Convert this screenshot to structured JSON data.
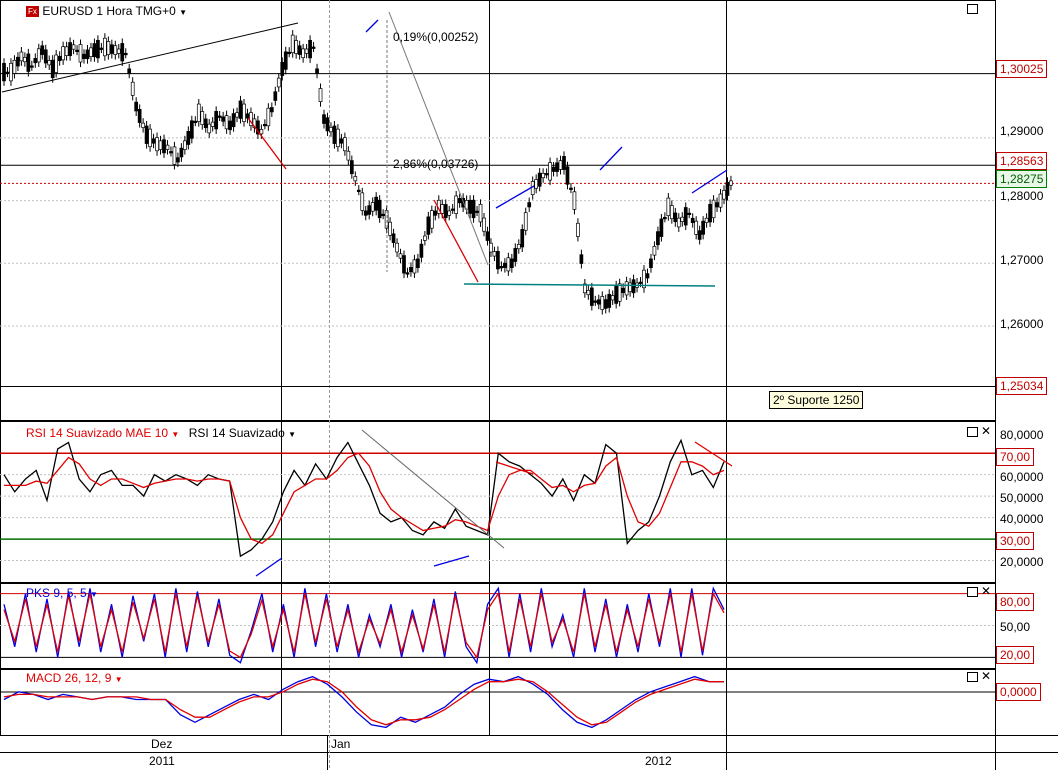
{
  "header": {
    "symbol_icon": "fx-icon",
    "title": "EURUSD 1 Hora TMG+0",
    "dropdown_icon": "triangle-down-icon"
  },
  "price_panel": {
    "axis_ticks": [
      "1,29000",
      "1,28000",
      "1,27000",
      "1,26000"
    ],
    "levels": [
      {
        "label": "1,30025",
        "style": "level"
      },
      {
        "label": "1,28563",
        "style": "level"
      },
      {
        "label": "1,28275",
        "style": "current"
      },
      {
        "label": "1,25034",
        "style": "level"
      }
    ],
    "annotations": {
      "fib_top": "0,19%(0,00252)",
      "fib_mid": "2,86%(0,03726)",
      "support_note": "2º Suporte 1250"
    }
  },
  "rsi_panel": {
    "title_red": "RSI 14 Suavizado MAE 10",
    "title_black": "RSI 14 Suavizado",
    "axis_ticks": [
      "80,0000",
      "60,0000",
      "50,0000",
      "40,0000",
      "20,0000"
    ],
    "levels": [
      "70,00",
      "30,00"
    ]
  },
  "pks_panel": {
    "title": "PKS 9, 5, 5",
    "axis_ticks": [
      "50,00"
    ],
    "levels": [
      "80,00",
      "20,00"
    ]
  },
  "macd_panel": {
    "title": "MACD 26, 12, 9",
    "levels": [
      "0,0000"
    ]
  },
  "time_axis": {
    "months": [
      "Dez",
      "Jan"
    ],
    "years": [
      "2011",
      "2012"
    ]
  },
  "colors": {
    "price": "#000000",
    "rising_candle": "#ffffff",
    "red": "#e00000",
    "blue": "#0000e0",
    "green": "#007000",
    "teal": "#008080",
    "grid": "#c0c0c0"
  },
  "chart_data": [
    {
      "type": "line",
      "title": "EURUSD 1 Hora TMG+0",
      "ylim": [
        1.245,
        1.312
      ],
      "series": [
        {
          "name": "EURUSD",
          "values": [
            1.3005,
            1.303,
            1.3015,
            1.304,
            1.301,
            1.3035,
            1.3045,
            1.303,
            1.304,
            1.3045,
            1.304,
            1.3035,
            1.295,
            1.2905,
            1.289,
            1.2885,
            1.2865,
            1.29,
            1.294,
            1.2915,
            1.2935,
            1.292,
            1.2945,
            1.293,
            1.291,
            1.2945,
            1.301,
            1.305,
            1.3035,
            1.3045,
            1.293,
            1.2905,
            1.289,
            1.2835,
            1.278,
            1.2795,
            1.277,
            1.2725,
            1.2685,
            1.27,
            1.276,
            1.279,
            1.278,
            1.28,
            1.279,
            1.278,
            1.2725,
            1.2695,
            1.27,
            1.274,
            1.282,
            1.284,
            1.285,
            1.286,
            1.28,
            1.266,
            1.264,
            1.2635,
            1.265,
            1.266,
            1.2665,
            1.268,
            1.274,
            1.279,
            1.2765,
            1.278,
            1.2745,
            1.278,
            1.28,
            1.2828
          ]
        }
      ]
    },
    {
      "type": "line",
      "title": "RSI 14 Suavizado MAE 10",
      "ylim": [
        10,
        85
      ],
      "series": [
        {
          "name": "RSI 14 Suavizado",
          "values": [
            60,
            52,
            58,
            62,
            48,
            72,
            75,
            58,
            52,
            60,
            62,
            55,
            55,
            50,
            60,
            57,
            60,
            58,
            55,
            60,
            58,
            57,
            22,
            25,
            30,
            38,
            52,
            62,
            55,
            65,
            58,
            68,
            75,
            65,
            55,
            42,
            38,
            40,
            34,
            32,
            38,
            35,
            44,
            36,
            34,
            32,
            70,
            66,
            64,
            60,
            56,
            50,
            58,
            48,
            60,
            56,
            74,
            70,
            28,
            34,
            38,
            50,
            66,
            76,
            60,
            62,
            54,
            66
          ]
        },
        {
          "name": "RSI 14 Suavizado MAE 10",
          "values": [
            55,
            55,
            55,
            57,
            56,
            62,
            68,
            65,
            58,
            55,
            58,
            58,
            56,
            54,
            56,
            57,
            58,
            58,
            57,
            58,
            58,
            57,
            40,
            30,
            28,
            32,
            42,
            52,
            55,
            58,
            58,
            62,
            68,
            70,
            64,
            52,
            44,
            40,
            37,
            34,
            35,
            36,
            39,
            38,
            36,
            34,
            50,
            60,
            62,
            62,
            58,
            54,
            55,
            52,
            55,
            56,
            64,
            68,
            50,
            38,
            36,
            42,
            54,
            66,
            66,
            64,
            60,
            62
          ]
        }
      ]
    },
    {
      "type": "line",
      "title": "PKS 9, 5, 5",
      "ylim": [
        10,
        90
      ],
      "series": [
        {
          "name": "PKS 9",
          "values": [
            70,
            30,
            80,
            25,
            75,
            20,
            82,
            30,
            85,
            25,
            70,
            20,
            78,
            35,
            80,
            20,
            85,
            25,
            82,
            30,
            75,
            22,
            15,
            45,
            80,
            25,
            70,
            20,
            85,
            30,
            80,
            25,
            70,
            20,
            60,
            30,
            70,
            20,
            65,
            25,
            75,
            20,
            82,
            30,
            15,
            70,
            85,
            20,
            80,
            25,
            85,
            30,
            60,
            20,
            85,
            25,
            75,
            20,
            70,
            25,
            80,
            30,
            85,
            20,
            85,
            22,
            85,
            65
          ]
        },
        {
          "name": "PKS 5",
          "values": [
            65,
            35,
            75,
            30,
            70,
            25,
            78,
            35,
            80,
            30,
            65,
            25,
            72,
            38,
            75,
            25,
            80,
            30,
            78,
            34,
            70,
            26,
            20,
            42,
            74,
            30,
            65,
            25,
            80,
            34,
            75,
            30,
            65,
            25,
            56,
            33,
            65,
            25,
            60,
            28,
            70,
            25,
            78,
            34,
            20,
            65,
            80,
            25,
            75,
            30,
            80,
            34,
            56,
            25,
            80,
            30,
            70,
            25,
            65,
            30,
            75,
            34,
            80,
            25,
            80,
            26,
            80,
            62
          ]
        }
      ]
    },
    {
      "type": "line",
      "title": "MACD 26, 12, 9",
      "series": [
        {
          "name": "MACD 26",
          "values": [
            0.0,
            0.3,
            0.2,
            0.0,
            0.2,
            0.1,
            0.0,
            0.1,
            0.1,
            0.0,
            0.0,
            0.0,
            -0.6,
            -0.9,
            -0.6,
            -0.3,
            0.0,
            0.2,
            0.0,
            0.4,
            0.7,
            0.9,
            0.6,
            0.1,
            -0.5,
            -1.0,
            -1.1,
            -0.7,
            -0.9,
            -0.6,
            -0.3,
            0.2,
            0.6,
            0.8,
            0.7,
            0.9,
            0.6,
            0.2,
            -0.4,
            -0.9,
            -1.1,
            -0.8,
            -0.4,
            0.0,
            0.3,
            0.5,
            0.7,
            0.9,
            0.7,
            0.7
          ]
        },
        {
          "name": "MACD 12",
          "values": [
            0.1,
            0.2,
            0.2,
            0.1,
            0.1,
            0.1,
            0.0,
            0.1,
            0.1,
            0.1,
            0.0,
            0.0,
            -0.4,
            -0.7,
            -0.7,
            -0.4,
            -0.1,
            0.1,
            0.1,
            0.3,
            0.6,
            0.8,
            0.7,
            0.3,
            -0.3,
            -0.8,
            -1.0,
            -0.8,
            -0.8,
            -0.7,
            -0.4,
            0.0,
            0.4,
            0.7,
            0.7,
            0.8,
            0.7,
            0.3,
            -0.2,
            -0.7,
            -1.0,
            -0.9,
            -0.5,
            -0.1,
            0.2,
            0.4,
            0.6,
            0.8,
            0.7,
            0.7
          ]
        }
      ]
    }
  ]
}
